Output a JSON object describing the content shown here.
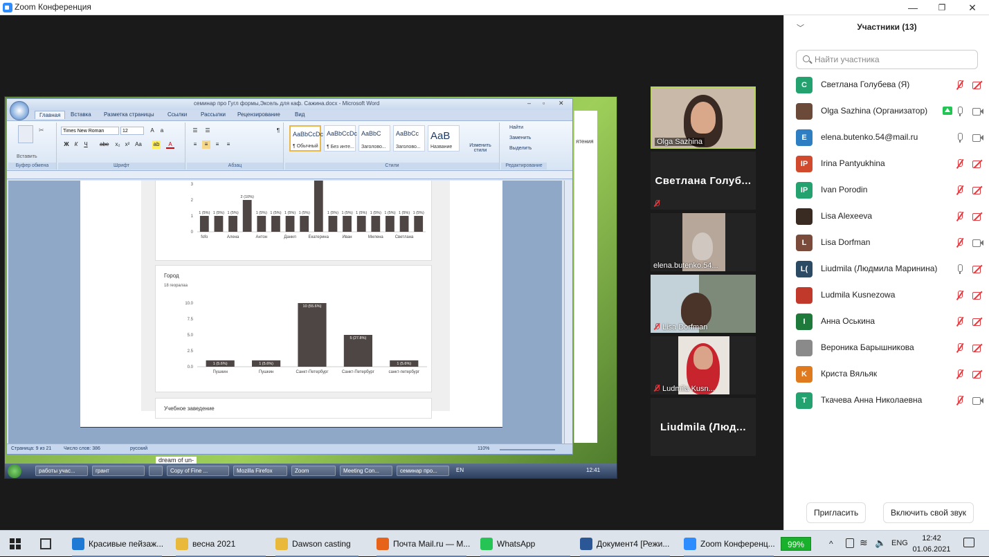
{
  "window": {
    "title": "Zoom Конференция",
    "minimize": "—",
    "maximize": "❐",
    "close": "✕"
  },
  "word": {
    "title": "семинар про Гугл формы,Эксель для каф. Сажина.docx - Microsoft Word",
    "tabs": [
      "Главная",
      "Вставка",
      "Разметка страницы",
      "Ссылки",
      "Рассылки",
      "Рецензирование",
      "Вид"
    ],
    "paste_label": "Вставить",
    "font_name": "Times New Roman",
    "font_size": "12",
    "groups": [
      "Буфер обмена",
      "Шрифт",
      "Абзац",
      "Стили",
      "Редактирование"
    ],
    "styles": [
      {
        "preview": "AaBbCcDc",
        "label": "¶ Обычный"
      },
      {
        "preview": "AaBbCcDc",
        "label": "¶ Без инте..."
      },
      {
        "preview": "AaBbC",
        "label": "Заголово..."
      },
      {
        "preview": "AaBbCc",
        "label": "Заголово..."
      },
      {
        "preview": "AaB",
        "label": "Название"
      }
    ],
    "change_styles": "Изменить стили",
    "edit": [
      "Найти",
      "Заменить",
      "Выделить"
    ],
    "status": {
      "page": "Страница: 9 из 21",
      "words": "Число слов: 386",
      "lang": "русский",
      "zoom": "110%"
    },
    "bg_fragment": "ятения"
  },
  "forms": {
    "card2_title": "Город",
    "card2_sub": "18 георалаа",
    "card3_title": "Учебное заведение"
  },
  "chart_data": [
    {
      "type": "bar",
      "categories": [
        "fofo",
        "",
        "Алена",
        "",
        "Антон",
        "",
        "Данил",
        "",
        "Екатерина",
        "",
        "Иван",
        "",
        "Милена",
        "",
        "Светлана",
        ""
      ],
      "values": [
        1,
        1,
        1,
        2,
        1,
        1,
        1,
        1,
        4,
        1,
        1,
        1,
        1,
        1,
        1,
        1
      ],
      "labels": [
        "1 (5%)",
        "1 (5%)",
        "1 (5%)",
        "2 (10%)",
        "1 (5%)",
        "1 (5%)",
        "1 (5%)",
        "1 (5%)",
        "",
        "1 (5%)",
        "1 (5%)",
        "1 (5%)",
        "1 (5%)",
        "1 (5%)",
        "1 (5%)",
        "1 (5%)"
      ],
      "yticks": [
        "0",
        "1",
        "2",
        "3"
      ],
      "ylim": [
        0,
        3
      ]
    },
    {
      "type": "bar",
      "categories": [
        "Пушкин",
        "Пушкин",
        "Санкт-Петербург",
        "Санкт-Петербург",
        "санкт-петербург"
      ],
      "values": [
        1,
        1,
        10,
        5,
        1
      ],
      "labels": [
        "1 (5.6%)",
        "1 (5.6%)",
        "10 (55.6%)",
        "5 (27.8%)",
        "1 (5.6%)"
      ],
      "yticks": [
        "0.0",
        "2.5",
        "5.0",
        "7.5",
        "10.0"
      ],
      "ylim": [
        0,
        10
      ]
    }
  ],
  "xp_taskbar": {
    "items": [
      "работы учас...",
      "грант",
      "",
      "Copy of Fine ...",
      "Mozilla Firefox",
      "Zoom",
      "Meeting Con...",
      "семинар про..."
    ],
    "lang": "EN",
    "time": "12:41",
    "caption": "dream of un-"
  },
  "tiles": [
    {
      "name": "Olga Sazhina"
    },
    {
      "big": "Светлана  Голуб..."
    },
    {
      "name": "elena.butenko.54..."
    },
    {
      "name": "Lisa Dorfman"
    },
    {
      "name": "Ludmila Kusn..."
    },
    {
      "big": "Liudmila  (Люд..."
    }
  ],
  "participants": {
    "header": "Участники (13)",
    "search_placeholder": "Найти участника",
    "list": [
      {
        "initials": "С",
        "color": "#23a26f",
        "name": "Светлана Голубева (Я)",
        "mic": "off",
        "cam": "off"
      },
      {
        "initials": "",
        "color": "#6b4a3a",
        "name": "Olga Sazhina (Организатор)",
        "mic": "on",
        "cam": "on",
        "share": true
      },
      {
        "initials": "E",
        "color": "#2d7ec2",
        "name": "elena.butenko.54@mail.ru",
        "mic": "on",
        "cam": "on"
      },
      {
        "initials": "IP",
        "color": "#d14a2e",
        "name": "Irina Pantyukhina",
        "mic": "off",
        "cam": "off"
      },
      {
        "initials": "IP",
        "color": "#23a26f",
        "name": "Ivan Porodin",
        "mic": "off",
        "cam": "off"
      },
      {
        "initials": "",
        "color": "#3a2b22",
        "name": "Lisa Alexeeva",
        "mic": "off",
        "cam": "off"
      },
      {
        "initials": "L",
        "color": "#7a4a3a",
        "name": "Lisa Dorfman",
        "mic": "off",
        "cam": "on"
      },
      {
        "initials": "L(",
        "color": "#2b4a63",
        "name": "Liudmila (Людмила Маринина)",
        "mic": "on",
        "cam": "off"
      },
      {
        "initials": "",
        "color": "#c0392b",
        "name": "Ludmila Kusnezowa",
        "mic": "off",
        "cam": "off"
      },
      {
        "initials": "I",
        "color": "#1e7a3a",
        "name": "Анна Оськина",
        "mic": "off",
        "cam": "off"
      },
      {
        "initials": "",
        "color": "#8a8a8a",
        "name": "Вероника Барышникова",
        "mic": "off",
        "cam": "off"
      },
      {
        "initials": "K",
        "color": "#e07a1f",
        "name": "Криста Вяльяк",
        "mic": "off",
        "cam": "off"
      },
      {
        "initials": "T",
        "color": "#23a26f",
        "name": "Ткачева Анна Николаевна",
        "mic": "off",
        "cam": "on"
      }
    ],
    "invite": "Пригласить",
    "unmute": "Включить свой звук"
  },
  "taskbar": {
    "items": [
      {
        "label": "Красивые пейзаж...",
        "color": "#1f7ad6"
      },
      {
        "label": "весна 2021",
        "color": "#e8b93a"
      },
      {
        "label": "Dawson casting",
        "color": "#e8b93a"
      },
      {
        "label": "Почта Mail.ru — M...",
        "color": "#e8631a"
      },
      {
        "label": "WhatsApp",
        "color": "#25c455"
      },
      {
        "label": "Документ4 [Режи...",
        "color": "#2b5797"
      },
      {
        "label": "Zoom Конференц...",
        "color": "#2d8cff"
      }
    ],
    "battery": "99%",
    "lang": "ENG",
    "time": "12:42",
    "date": "01.06.2021"
  }
}
